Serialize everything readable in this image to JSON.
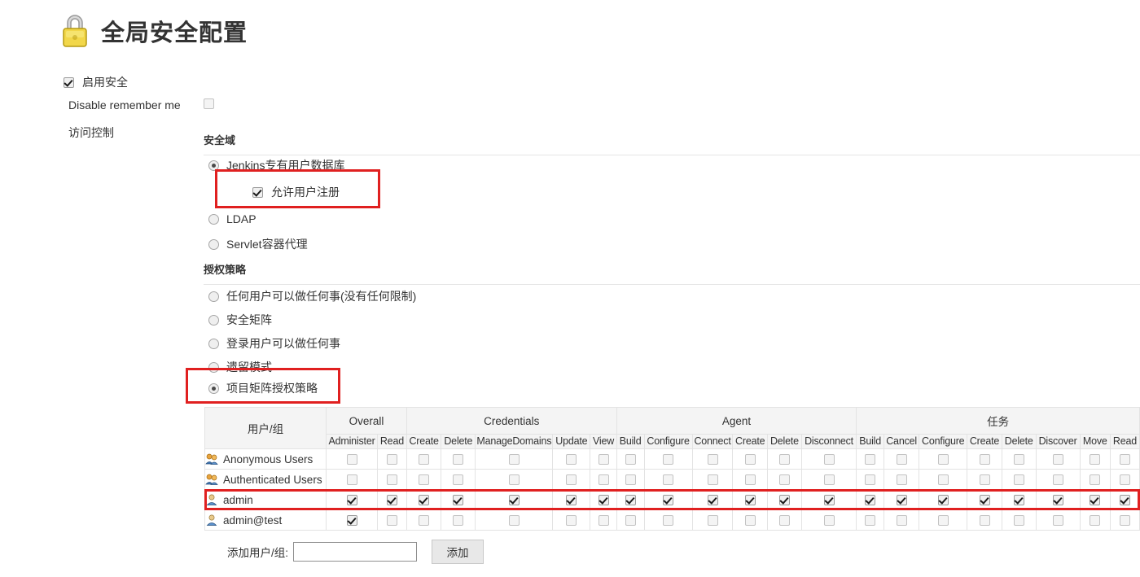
{
  "page": {
    "title": "全局安全配置",
    "lock_icon": "padlock-icon"
  },
  "form": {
    "enable_security_label": "启用安全",
    "enable_security_checked": true,
    "disable_remember_me_label": "Disable remember me",
    "disable_remember_me_checked": false,
    "access_control_label": "访问控制"
  },
  "security_realm": {
    "header": "安全域",
    "options": [
      {
        "label": "Jenkins专有用户数据库",
        "selected": true
      },
      {
        "label": "LDAP",
        "selected": false
      },
      {
        "label": "Servlet容器代理",
        "selected": false
      }
    ],
    "allow_signup": {
      "label": "允许用户注册",
      "checked": true
    }
  },
  "authorization": {
    "header": "授权策略",
    "options": [
      {
        "label": "任何用户可以做任何事(没有任何限制)",
        "selected": false
      },
      {
        "label": "安全矩阵",
        "selected": false
      },
      {
        "label": "登录用户可以做任何事",
        "selected": false
      },
      {
        "label": "遗留模式",
        "selected": false
      },
      {
        "label": "项目矩阵授权策略",
        "selected": true
      }
    ]
  },
  "matrix": {
    "user_column_header": "用户/组",
    "groups": [
      {
        "name": "Overall",
        "permissions": [
          "Administer",
          "Read"
        ]
      },
      {
        "name": "Credentials",
        "permissions": [
          "Create",
          "Delete",
          "ManageDomains",
          "Update",
          "View"
        ]
      },
      {
        "name": "Agent",
        "permissions": [
          "Build",
          "Configure",
          "Connect",
          "Create",
          "Delete",
          "Disconnect"
        ]
      },
      {
        "name": "任务",
        "permissions": [
          "Build",
          "Cancel",
          "Configure",
          "Create",
          "Delete",
          "Discover",
          "Move",
          "Read"
        ]
      }
    ],
    "rows": [
      {
        "name": "Anonymous Users",
        "icon": "user-group-icon",
        "checks": [
          false,
          false,
          false,
          false,
          false,
          false,
          false,
          false,
          false,
          false,
          false,
          false,
          false,
          false,
          false,
          false,
          false,
          false,
          false,
          false,
          false
        ]
      },
      {
        "name": "Authenticated Users",
        "icon": "user-group-icon",
        "checks": [
          false,
          false,
          false,
          false,
          false,
          false,
          false,
          false,
          false,
          false,
          false,
          false,
          false,
          false,
          false,
          false,
          false,
          false,
          false,
          false,
          false
        ]
      },
      {
        "name": "admin",
        "icon": "user-icon",
        "checks": [
          true,
          true,
          true,
          true,
          true,
          true,
          true,
          true,
          true,
          true,
          true,
          true,
          true,
          true,
          true,
          true,
          true,
          true,
          true,
          true,
          true
        ]
      },
      {
        "name": "admin@test",
        "icon": "user-icon",
        "checks": [
          true,
          false,
          false,
          false,
          false,
          false,
          false,
          false,
          false,
          false,
          false,
          false,
          false,
          false,
          false,
          false,
          false,
          false,
          false,
          false,
          false
        ]
      }
    ]
  },
  "add_user": {
    "label": "添加用户/组:",
    "input_value": "",
    "input_placeholder": "",
    "button_label": "添加"
  },
  "annotations": {
    "color": "#e02020",
    "boxes": [
      "allow-signup-highlight",
      "project-matrix-highlight",
      "admin-row-highlight"
    ]
  }
}
